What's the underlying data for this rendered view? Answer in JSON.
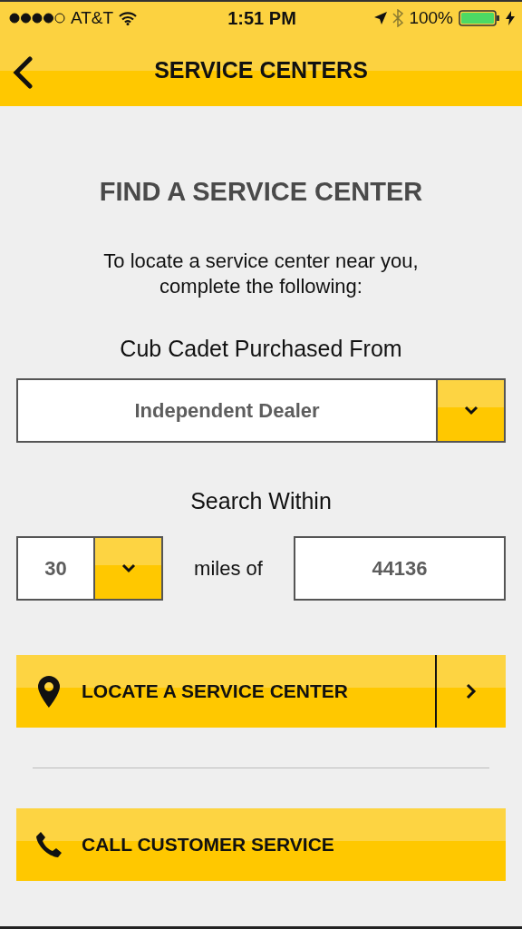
{
  "status_bar": {
    "carrier": "AT&T",
    "time": "1:51 PM",
    "battery": "100%"
  },
  "nav": {
    "title": "SERVICE CENTERS"
  },
  "heading": "FIND A SERVICE CENTER",
  "instructions": "To locate a service center near you, complete the following:",
  "purchased_from": {
    "label": "Cub Cadet Purchased From",
    "value": "Independent Dealer"
  },
  "search_within": {
    "label": "Search Within",
    "miles": "30",
    "connector": "miles of",
    "zip": "44136"
  },
  "buttons": [
    {
      "kind": "locate",
      "label": "LOCATE A SERVICE CENTER"
    },
    {
      "kind": "call",
      "label": "CALL CUSTOMER SERVICE"
    }
  ]
}
